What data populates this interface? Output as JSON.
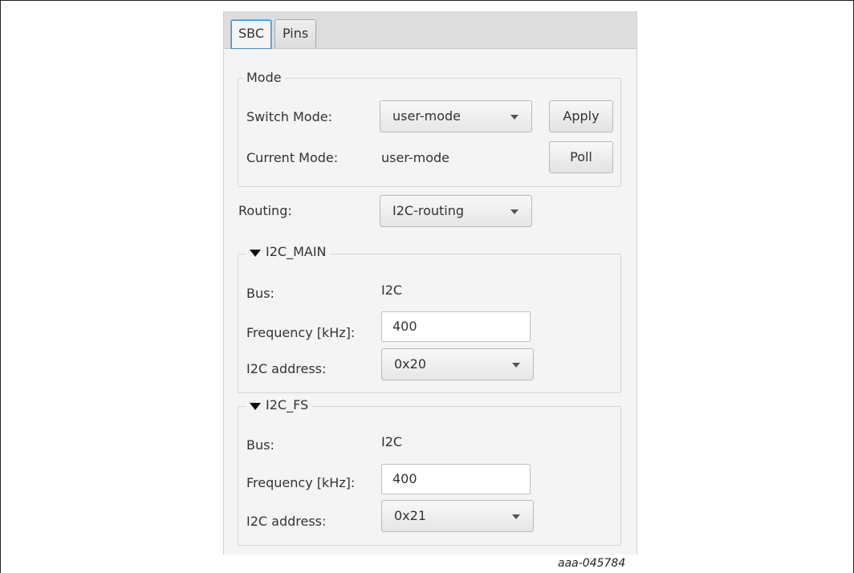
{
  "tabs": [
    {
      "label": "SBC",
      "active": true
    },
    {
      "label": "Pins",
      "active": false
    }
  ],
  "mode": {
    "title": "Mode",
    "switch_label": "Switch Mode:",
    "switch_value": "user-mode",
    "apply_label": "Apply",
    "current_label": "Current Mode:",
    "current_value": "user-mode",
    "poll_label": "Poll"
  },
  "routing": {
    "label": "Routing:",
    "value": "I2C-routing"
  },
  "i2c_main": {
    "title": "I2C_MAIN",
    "bus_label": "Bus:",
    "bus_value": "I2C",
    "freq_label": "Frequency [kHz]:",
    "freq_value": "400",
    "addr_label": "I2C address:",
    "addr_value": "0x20"
  },
  "i2c_fs": {
    "title": "I2C_FS",
    "bus_label": "Bus:",
    "bus_value": "I2C",
    "freq_label": "Frequency [kHz]:",
    "freq_value": "400",
    "addr_label": "I2C address:",
    "addr_value": "0x21"
  },
  "caption": "aaa-045784",
  "colors": {
    "panel_bg": "#f4f4f4",
    "tabbar_bg": "#dddddd",
    "focus_ring": "#3a8fd5"
  }
}
